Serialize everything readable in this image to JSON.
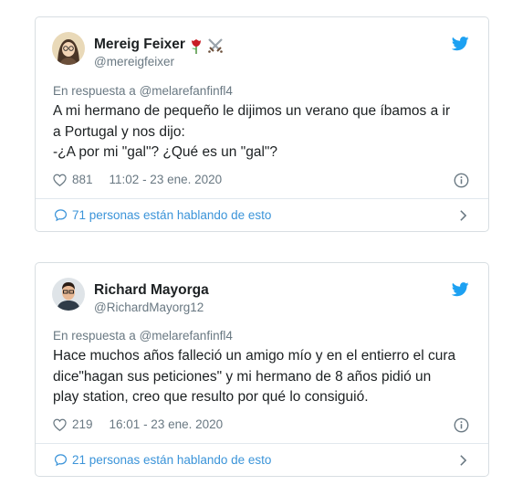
{
  "tweets": [
    {
      "name": "Mereig Feixer",
      "handle": "@mereigfeixer",
      "reply_prefix": "En respuesta a",
      "reply_to": "@melarefanfinfl4",
      "text_lines": [
        "A mi hermano de pequeño le dijimos un verano que íbamos a ir",
        "a Portugal y nos dijo:",
        "-¿A por mi \"gal\"? ¿Qué es un \"gal\"?"
      ],
      "likes": "881",
      "timestamp": "11:02 - 23 ene. 2020",
      "talking": "71 personas están hablando de esto",
      "emojis": [
        "rose-icon",
        "crossed-swords-icon"
      ]
    },
    {
      "name": "Richard Mayorga",
      "handle": "@RichardMayorg12",
      "reply_prefix": "En respuesta a",
      "reply_to": "@melarefanfinfl4",
      "text_lines": [
        "Hace muchos años falleció un amigo mío y en el entierro el cura",
        "dice\"hagan sus peticiones\" y mi hermano de 8 años pidió un",
        "play station, creo que resulto por qué lo consiguió."
      ],
      "likes": "219",
      "timestamp": "16:01 - 23 ene. 2020",
      "talking": "21 personas están hablando de esto"
    }
  ],
  "colors": {
    "twitter_blue": "#1da1f2",
    "link_blue": "#3b94d9",
    "muted": "#697882",
    "border": "#d8dee2"
  }
}
